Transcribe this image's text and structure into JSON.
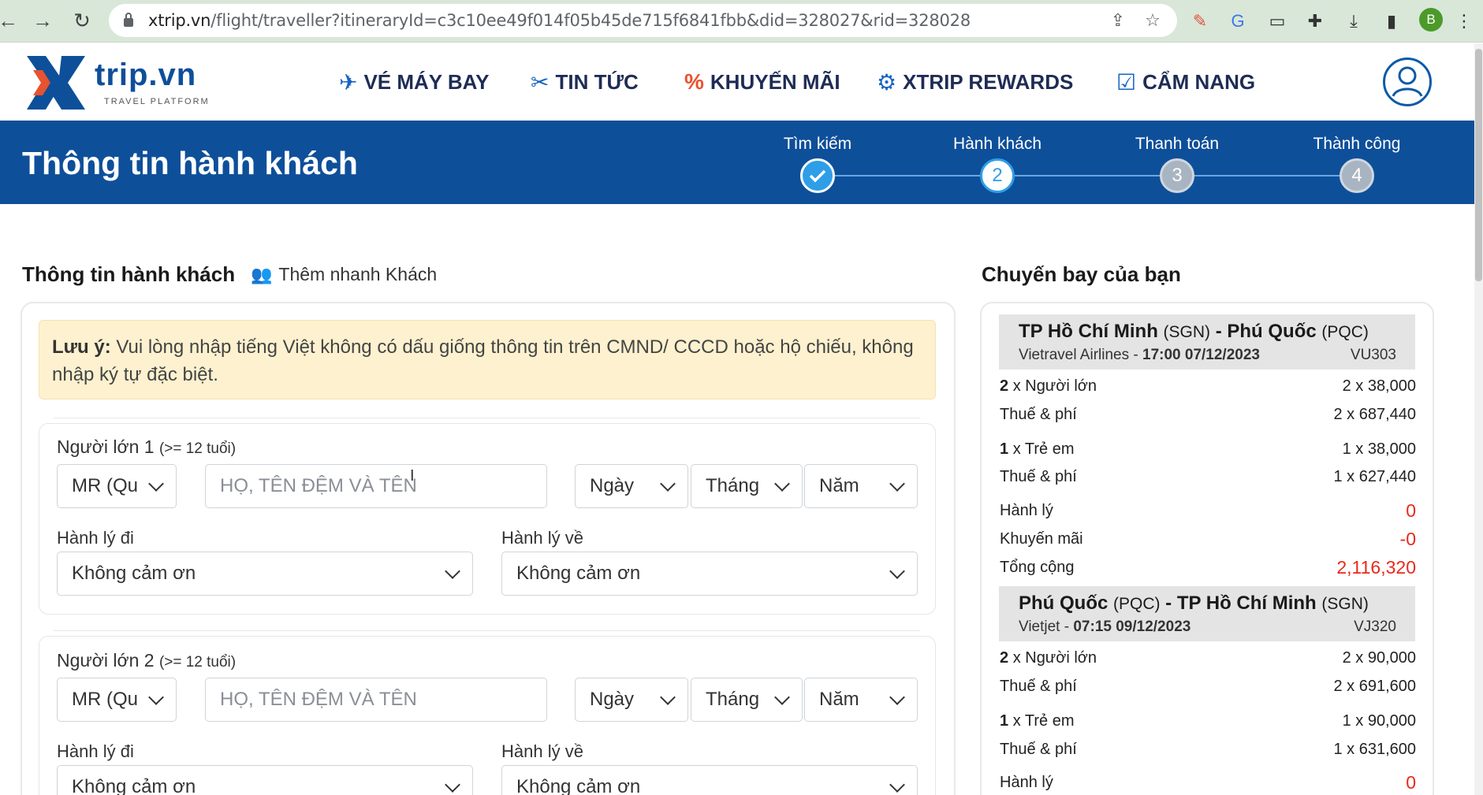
{
  "browser": {
    "url_host": "xtrip.vn",
    "url_path": "/flight/traveller?itineraryId=c3c10ee49f014f05b45de715f6841fbb&did=328027&rid=328028",
    "profile_initial": "B"
  },
  "header": {
    "logo_text": "trip.vn",
    "logo_tagline": "TRAVEL PLATFORM",
    "nav": [
      {
        "label": "VÉ MÁY BAY",
        "icon": "plane-icon"
      },
      {
        "label": "TIN TỨC",
        "icon": "news-icon"
      },
      {
        "label": "KHUYẾN MÃI",
        "icon": "percent-icon"
      },
      {
        "label": "XTRIP REWARDS",
        "icon": "handshake-icon"
      },
      {
        "label": "CẨM NANG",
        "icon": "guide-icon"
      }
    ]
  },
  "banner": {
    "title": "Thông tin hành khách",
    "steps": [
      {
        "label": "Tìm kiếm",
        "number": "1",
        "state": "done"
      },
      {
        "label": "Hành khách",
        "number": "2",
        "state": "current"
      },
      {
        "label": "Thanh toán",
        "number": "3",
        "state": "todo"
      },
      {
        "label": "Thành công",
        "number": "4",
        "state": "todo"
      }
    ]
  },
  "form": {
    "section_title": "Thông tin hành khách",
    "quick_add_label": "Thêm nhanh Khách",
    "note_label": "Lưu ý:",
    "note_text": " Vui lòng nhập tiếng Việt không có dấu giống thông tin trên CMND/ CCCD hoặc hộ chiếu, không nhập ký tự đặc biệt.",
    "passengers": [
      {
        "title": "Người lớn 1",
        "age_note": "(>= 12 tuổi)",
        "title_select": "MR (Qu",
        "name_placeholder": "HỌ, TÊN ĐỆM VÀ TÊN",
        "day": "Ngày",
        "month": "Tháng",
        "year": "Năm",
        "baggage_out_label": "Hành lý đi",
        "baggage_out_value": "Không cảm ơn",
        "baggage_ret_label": "Hành lý về",
        "baggage_ret_value": "Không cảm ơn"
      },
      {
        "title": "Người lớn 2",
        "age_note": "(>= 12 tuổi)",
        "title_select": "MR (Qu",
        "name_placeholder": "HỌ, TÊN ĐỆM VÀ TÊN",
        "day": "Ngày",
        "month": "Tháng",
        "year": "Năm",
        "baggage_out_label": "Hành lý đi",
        "baggage_out_value": "Không cảm ơn",
        "baggage_ret_label": "Hành lý về",
        "baggage_ret_value": "Không cảm ơn"
      }
    ]
  },
  "summary": {
    "title": "Chuyến bay của bạn",
    "outbound": {
      "from": "TP Hồ Chí Minh",
      "from_code": "(SGN)",
      "to": "Phú Quốc",
      "to_code": "(PQC)",
      "airline": "Vietravel Airlines",
      "datetime": "17:00 07/12/2023",
      "flight_no": "VU303",
      "adult_qty": "2",
      "adult_label": "x Người lớn",
      "adult_price": "2 x 38,000",
      "adult_tax_label": "Thuế & phí",
      "adult_tax": "2 x 687,440",
      "child_qty": "1",
      "child_label": "x Trẻ em",
      "child_price": "1 x 38,000",
      "child_tax_label": "Thuế & phí",
      "child_tax": "1 x 627,440",
      "baggage_label": "Hành lý",
      "baggage": "0",
      "promo_label": "Khuyến mãi",
      "promo": "-0",
      "total_label": "Tổng cộng",
      "total": "2,116,320"
    },
    "inbound": {
      "from": "Phú Quốc",
      "from_code": "(PQC)",
      "to": "TP Hồ Chí Minh",
      "to_code": "(SGN)",
      "airline": "Vietjet",
      "datetime": "07:15 09/12/2023",
      "flight_no": "VJ320",
      "adult_qty": "2",
      "adult_label": "x Người lớn",
      "adult_price": "2 x 90,000",
      "adult_tax_label": "Thuế & phí",
      "adult_tax": "2 x 691,600",
      "child_qty": "1",
      "child_label": "x Trẻ em",
      "child_price": "1 x 90,000",
      "child_tax_label": "Thuế & phí",
      "child_tax": "1 x 631,600",
      "baggage_label": "Hành lý",
      "baggage": "0"
    }
  },
  "colors": {
    "brand_blue": "#0e4f9a",
    "accent_red": "#e8291c",
    "note_bg": "#fdf1cf"
  }
}
